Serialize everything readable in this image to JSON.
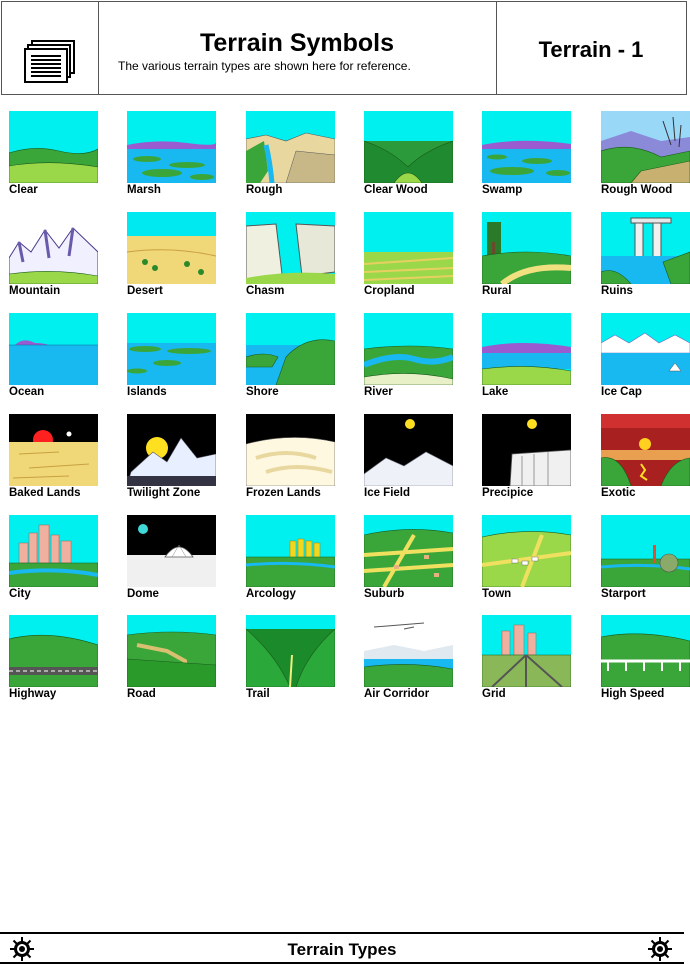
{
  "header": {
    "title": "Terrain Symbols",
    "subtitle": "The various terrain types are shown here for reference.",
    "code": "Terrain - 1"
  },
  "terrains": [
    {
      "label": "Clear",
      "scene": "clear"
    },
    {
      "label": "Marsh",
      "scene": "marsh"
    },
    {
      "label": "Rough",
      "scene": "rough"
    },
    {
      "label": "Clear Wood",
      "scene": "clearwood"
    },
    {
      "label": "Swamp",
      "scene": "swamp"
    },
    {
      "label": "Rough Wood",
      "scene": "roughwood"
    },
    {
      "label": "Mountain",
      "scene": "mountain"
    },
    {
      "label": "Desert",
      "scene": "desert"
    },
    {
      "label": "Chasm",
      "scene": "chasm"
    },
    {
      "label": "Cropland",
      "scene": "cropland"
    },
    {
      "label": "Rural",
      "scene": "rural"
    },
    {
      "label": "Ruins",
      "scene": "ruins"
    },
    {
      "label": "Ocean",
      "scene": "ocean"
    },
    {
      "label": "Islands",
      "scene": "islands"
    },
    {
      "label": "Shore",
      "scene": "shore"
    },
    {
      "label": "River",
      "scene": "river"
    },
    {
      "label": "Lake",
      "scene": "lake"
    },
    {
      "label": "Ice Cap",
      "scene": "icecap"
    },
    {
      "label": "Baked Lands",
      "scene": "baked"
    },
    {
      "label": "Twilight Zone",
      "scene": "twilight"
    },
    {
      "label": "Frozen Lands",
      "scene": "frozen"
    },
    {
      "label": "Ice Field",
      "scene": "icefield"
    },
    {
      "label": "Precipice",
      "scene": "precipice"
    },
    {
      "label": "Exotic",
      "scene": "exotic"
    },
    {
      "label": "City",
      "scene": "city"
    },
    {
      "label": "Dome",
      "scene": "dome"
    },
    {
      "label": "Arcology",
      "scene": "arcology"
    },
    {
      "label": "Suburb",
      "scene": "suburb"
    },
    {
      "label": "Town",
      "scene": "town"
    },
    {
      "label": "Starport",
      "scene": "starport"
    },
    {
      "label": "Highway",
      "scene": "highway"
    },
    {
      "label": "Road",
      "scene": "road"
    },
    {
      "label": "Trail",
      "scene": "trail"
    },
    {
      "label": "Air Corridor",
      "scene": "aircorridor"
    },
    {
      "label": "Grid",
      "scene": "grid"
    },
    {
      "label": "High Speed",
      "scene": "highspeed"
    }
  ],
  "footer": {
    "title": "Terrain Types"
  },
  "colors": {
    "sky": "#00f0f0",
    "grass": "#3aa63a",
    "light_grass": "#9ad84a",
    "water": "#18b8f0",
    "purple": "#9a5ad0",
    "sand": "#f0d878",
    "night": "#000000"
  }
}
